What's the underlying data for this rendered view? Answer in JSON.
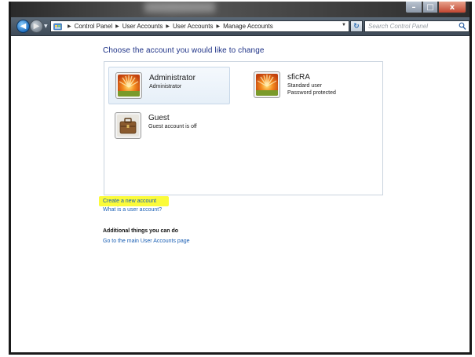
{
  "window": {
    "controls": {
      "minimize": "–",
      "maximize": "□",
      "close": "x"
    }
  },
  "navbar": {
    "breadcrumb": [
      "Control Panel",
      "User Accounts",
      "User Accounts",
      "Manage Accounts"
    ],
    "search_placeholder": "Search Control Panel",
    "back_glyph": "◀",
    "forward_glyph": "▶",
    "dropdown_glyph": "▼",
    "refresh_glyph": "↻",
    "separator_glyph": "▶"
  },
  "main": {
    "heading": "Choose the account you would like to change",
    "accounts": [
      {
        "name": "Administrator",
        "details": [
          "Administrator"
        ],
        "avatar": "orange-flower-avatar-icon",
        "selected": true
      },
      {
        "name": "sficRA",
        "details": [
          "Standard user",
          "Password protected"
        ],
        "avatar": "orange-flower-avatar-icon",
        "selected": false
      },
      {
        "name": "Guest",
        "details": [
          "Guest account is off"
        ],
        "avatar": "briefcase-avatar-icon",
        "selected": false
      }
    ],
    "links": {
      "create_account": "Create a new account",
      "what_is_account": "What is a user account?"
    },
    "additional_title": "Additional things you can do",
    "additional_links": [
      "Go to the main User Accounts page"
    ]
  },
  "colors": {
    "heading": "#1e3287",
    "link": "#1a5fb4",
    "highlight": "#fbfb3a",
    "selected_tile": "#e6eff8"
  }
}
